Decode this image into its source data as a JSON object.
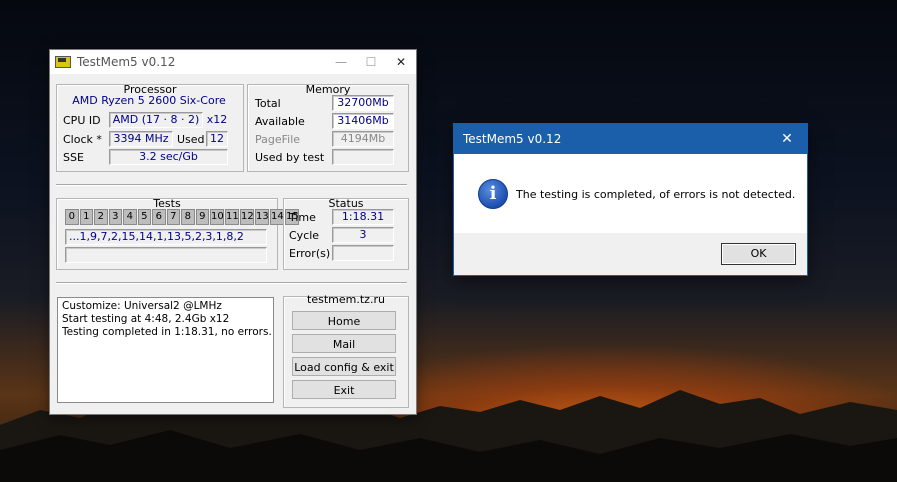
{
  "testmem": {
    "title": "TestMem5 v0.12",
    "processor": {
      "section_title": "Processor",
      "cpu_name": "AMD Ryzen 5 2600 Six-Core",
      "cpu_id_label": "CPU ID",
      "cpu_id_value": "AMD  (17 · 8 · 2)",
      "threads": "x12",
      "clock_label": "Clock *",
      "clock_value": "3394 MHz",
      "used_label": "Used",
      "used_value": "12",
      "sse_label": "SSE",
      "sse_value": "3.2 sec/Gb"
    },
    "memory": {
      "section_title": "Memory",
      "total_label": "Total",
      "total_value": "32700Mb",
      "available_label": "Available",
      "available_value": "31406Mb",
      "pagefile_label": "PageFile",
      "pagefile_value": "4194Mb",
      "used_by_test_label": "Used by test",
      "used_by_test_value": ""
    },
    "tests": {
      "section_title": "Tests",
      "cells": [
        "0",
        "1",
        "2",
        "3",
        "4",
        "5",
        "6",
        "7",
        "8",
        "9",
        "10",
        "11",
        "12",
        "13",
        "14",
        "15"
      ],
      "sequence": "...1,9,7,2,15,14,1,13,5,2,3,1,8,2",
      "extra": ""
    },
    "status": {
      "section_title": "Status",
      "time_label": "Time",
      "time_value": "1:18.31",
      "cycle_label": "Cycle",
      "cycle_value": "3",
      "errors_label": "Error(s)",
      "errors_value": ""
    },
    "log": [
      "Customize: Universal2 @LMHz",
      "Start testing at 4:48, 2.4Gb x12",
      "Testing completed in 1:18.31, no errors."
    ],
    "links": {
      "site": "testmem.tz.ru",
      "home": "Home",
      "mail": "Mail",
      "load_config": "Load config & exit",
      "exit": "Exit"
    }
  },
  "dialog": {
    "title": "TestMem5 v0.12",
    "message": "The testing is completed, of errors is not detected.",
    "ok": "OK",
    "close_glyph": "✕",
    "icon": "info-icon"
  },
  "window_controls": {
    "minimize": "—",
    "maximize": "☐",
    "close": "✕"
  }
}
